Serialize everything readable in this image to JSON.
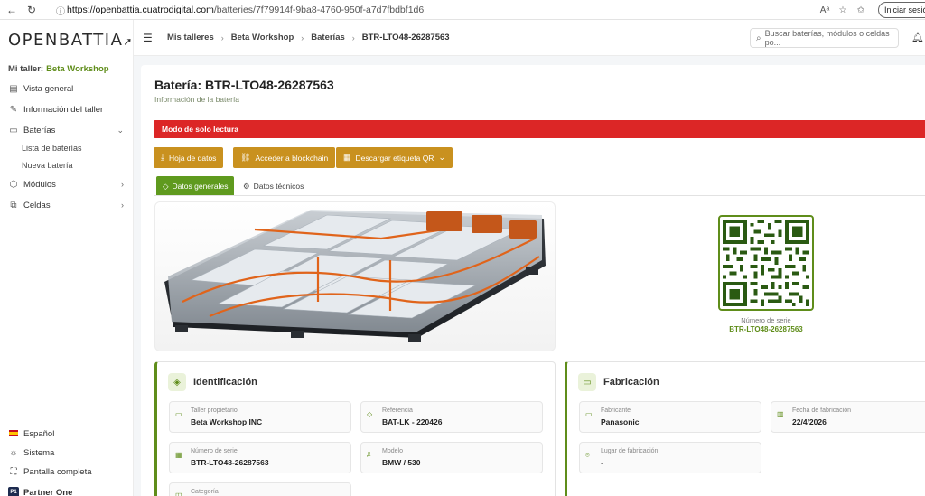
{
  "browser": {
    "url_domain": "https://openbattia.cuatrodigital.com",
    "url_path": "/batteries/7f79914f-9ba8-4760-950f-a7d7fbdbf1d6",
    "login_label": "Iniciar sesión"
  },
  "sidebar": {
    "logo": "OPENBATTIA",
    "workshop_label": "Mi taller:",
    "workshop_value": "Beta Workshop",
    "items": [
      {
        "label": "Vista general"
      },
      {
        "label": "Información del taller"
      },
      {
        "label": "Baterías"
      },
      {
        "label": "Módulos"
      },
      {
        "label": "Celdas"
      }
    ],
    "sub_items": [
      {
        "label": "Lista de baterías"
      },
      {
        "label": "Nueva batería"
      }
    ],
    "bottom": {
      "language": "Español",
      "system": "Sistema",
      "fullscreen": "Pantalla completa",
      "partner": "Partner One"
    }
  },
  "header": {
    "breadcrumb": [
      "Mis talleres",
      "Beta Workshop",
      "Baterías",
      "BTR-LTO48-26287563"
    ],
    "search_placeholder": "Buscar baterías, módulos o celdas po..."
  },
  "page": {
    "title": "Batería: BTR-LTO48-26287563",
    "subtitle": "Información de la batería",
    "alert": "Modo de solo lectura",
    "actions": {
      "datasheet": "Hoja de datos",
      "blockchain": "Acceder a blockchain",
      "qr": "Descargar etiqueta QR"
    },
    "tabs": {
      "general": "Datos generales",
      "technical": "Datos técnicos"
    },
    "qr": {
      "serial_label": "Número de serie",
      "serial_value": "BTR-LTO48-26287563"
    }
  },
  "identification": {
    "title": "Identificación",
    "fields": [
      {
        "label": "Taller propietario",
        "value": "Beta Workshop INC"
      },
      {
        "label": "Referencia",
        "value": "BAT-LK - 220426"
      },
      {
        "label": "Número de serie",
        "value": "BTR-LTO48-26287563"
      },
      {
        "label": "Modelo",
        "value": "BMW / 530"
      },
      {
        "label": "Categoría",
        "value": ""
      }
    ]
  },
  "manufacturing": {
    "title": "Fabricación",
    "fields": [
      {
        "label": "Fabricante",
        "value": "Panasonic"
      },
      {
        "label": "Fecha de fabricación",
        "value": "22/4/2026"
      },
      {
        "label": "Lugar de fabricación",
        "value": "-"
      }
    ]
  },
  "colors": {
    "brand_green": "#5f8d1a",
    "alert_red": "#dc2626",
    "action_gold": "#c9911f",
    "tab_green": "#5f9a1e"
  }
}
